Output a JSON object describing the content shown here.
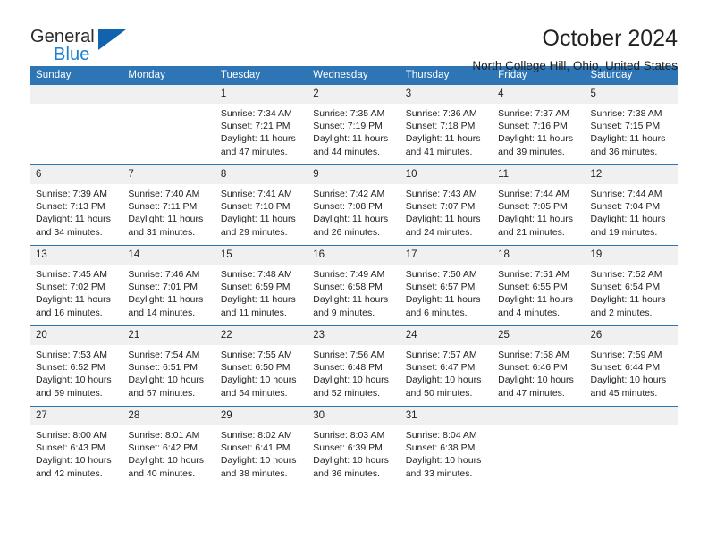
{
  "brand": {
    "name_part1": "General",
    "name_part2": "Blue",
    "flag_icon": "blue-triangle-flag",
    "accent_color": "#1263ad",
    "accent_color_light": "#1b7fd4"
  },
  "header": {
    "title": "October 2024",
    "subtitle": "North College Hill, Ohio, United States"
  },
  "theme": {
    "header_bar_color": "#2e75b6",
    "daynum_band_color": "#f0f0f0",
    "row_divider_color": "#2e75b6",
    "text_color": "#222222"
  },
  "weekdays": [
    "Sunday",
    "Monday",
    "Tuesday",
    "Wednesday",
    "Thursday",
    "Friday",
    "Saturday"
  ],
  "labels": {
    "sunrise_prefix": "Sunrise: ",
    "sunset_prefix": "Sunset: ",
    "daylight_prefix": "Daylight: "
  },
  "weeks": [
    [
      {
        "day": "",
        "empty": true
      },
      {
        "day": "",
        "empty": true
      },
      {
        "day": "1",
        "sunrise": "Sunrise: 7:34 AM",
        "sunset": "Sunset: 7:21 PM",
        "daylight_line1": "Daylight: 11 hours",
        "daylight_line2": "and 47 minutes."
      },
      {
        "day": "2",
        "sunrise": "Sunrise: 7:35 AM",
        "sunset": "Sunset: 7:19 PM",
        "daylight_line1": "Daylight: 11 hours",
        "daylight_line2": "and 44 minutes."
      },
      {
        "day": "3",
        "sunrise": "Sunrise: 7:36 AM",
        "sunset": "Sunset: 7:18 PM",
        "daylight_line1": "Daylight: 11 hours",
        "daylight_line2": "and 41 minutes."
      },
      {
        "day": "4",
        "sunrise": "Sunrise: 7:37 AM",
        "sunset": "Sunset: 7:16 PM",
        "daylight_line1": "Daylight: 11 hours",
        "daylight_line2": "and 39 minutes."
      },
      {
        "day": "5",
        "sunrise": "Sunrise: 7:38 AM",
        "sunset": "Sunset: 7:15 PM",
        "daylight_line1": "Daylight: 11 hours",
        "daylight_line2": "and 36 minutes."
      }
    ],
    [
      {
        "day": "6",
        "sunrise": "Sunrise: 7:39 AM",
        "sunset": "Sunset: 7:13 PM",
        "daylight_line1": "Daylight: 11 hours",
        "daylight_line2": "and 34 minutes."
      },
      {
        "day": "7",
        "sunrise": "Sunrise: 7:40 AM",
        "sunset": "Sunset: 7:11 PM",
        "daylight_line1": "Daylight: 11 hours",
        "daylight_line2": "and 31 minutes."
      },
      {
        "day": "8",
        "sunrise": "Sunrise: 7:41 AM",
        "sunset": "Sunset: 7:10 PM",
        "daylight_line1": "Daylight: 11 hours",
        "daylight_line2": "and 29 minutes."
      },
      {
        "day": "9",
        "sunrise": "Sunrise: 7:42 AM",
        "sunset": "Sunset: 7:08 PM",
        "daylight_line1": "Daylight: 11 hours",
        "daylight_line2": "and 26 minutes."
      },
      {
        "day": "10",
        "sunrise": "Sunrise: 7:43 AM",
        "sunset": "Sunset: 7:07 PM",
        "daylight_line1": "Daylight: 11 hours",
        "daylight_line2": "and 24 minutes."
      },
      {
        "day": "11",
        "sunrise": "Sunrise: 7:44 AM",
        "sunset": "Sunset: 7:05 PM",
        "daylight_line1": "Daylight: 11 hours",
        "daylight_line2": "and 21 minutes."
      },
      {
        "day": "12",
        "sunrise": "Sunrise: 7:44 AM",
        "sunset": "Sunset: 7:04 PM",
        "daylight_line1": "Daylight: 11 hours",
        "daylight_line2": "and 19 minutes."
      }
    ],
    [
      {
        "day": "13",
        "sunrise": "Sunrise: 7:45 AM",
        "sunset": "Sunset: 7:02 PM",
        "daylight_line1": "Daylight: 11 hours",
        "daylight_line2": "and 16 minutes."
      },
      {
        "day": "14",
        "sunrise": "Sunrise: 7:46 AM",
        "sunset": "Sunset: 7:01 PM",
        "daylight_line1": "Daylight: 11 hours",
        "daylight_line2": "and 14 minutes."
      },
      {
        "day": "15",
        "sunrise": "Sunrise: 7:48 AM",
        "sunset": "Sunset: 6:59 PM",
        "daylight_line1": "Daylight: 11 hours",
        "daylight_line2": "and 11 minutes."
      },
      {
        "day": "16",
        "sunrise": "Sunrise: 7:49 AM",
        "sunset": "Sunset: 6:58 PM",
        "daylight_line1": "Daylight: 11 hours",
        "daylight_line2": "and 9 minutes."
      },
      {
        "day": "17",
        "sunrise": "Sunrise: 7:50 AM",
        "sunset": "Sunset: 6:57 PM",
        "daylight_line1": "Daylight: 11 hours",
        "daylight_line2": "and 6 minutes."
      },
      {
        "day": "18",
        "sunrise": "Sunrise: 7:51 AM",
        "sunset": "Sunset: 6:55 PM",
        "daylight_line1": "Daylight: 11 hours",
        "daylight_line2": "and 4 minutes."
      },
      {
        "day": "19",
        "sunrise": "Sunrise: 7:52 AM",
        "sunset": "Sunset: 6:54 PM",
        "daylight_line1": "Daylight: 11 hours",
        "daylight_line2": "and 2 minutes."
      }
    ],
    [
      {
        "day": "20",
        "sunrise": "Sunrise: 7:53 AM",
        "sunset": "Sunset: 6:52 PM",
        "daylight_line1": "Daylight: 10 hours",
        "daylight_line2": "and 59 minutes."
      },
      {
        "day": "21",
        "sunrise": "Sunrise: 7:54 AM",
        "sunset": "Sunset: 6:51 PM",
        "daylight_line1": "Daylight: 10 hours",
        "daylight_line2": "and 57 minutes."
      },
      {
        "day": "22",
        "sunrise": "Sunrise: 7:55 AM",
        "sunset": "Sunset: 6:50 PM",
        "daylight_line1": "Daylight: 10 hours",
        "daylight_line2": "and 54 minutes."
      },
      {
        "day": "23",
        "sunrise": "Sunrise: 7:56 AM",
        "sunset": "Sunset: 6:48 PM",
        "daylight_line1": "Daylight: 10 hours",
        "daylight_line2": "and 52 minutes."
      },
      {
        "day": "24",
        "sunrise": "Sunrise: 7:57 AM",
        "sunset": "Sunset: 6:47 PM",
        "daylight_line1": "Daylight: 10 hours",
        "daylight_line2": "and 50 minutes."
      },
      {
        "day": "25",
        "sunrise": "Sunrise: 7:58 AM",
        "sunset": "Sunset: 6:46 PM",
        "daylight_line1": "Daylight: 10 hours",
        "daylight_line2": "and 47 minutes."
      },
      {
        "day": "26",
        "sunrise": "Sunrise: 7:59 AM",
        "sunset": "Sunset: 6:44 PM",
        "daylight_line1": "Daylight: 10 hours",
        "daylight_line2": "and 45 minutes."
      }
    ],
    [
      {
        "day": "27",
        "sunrise": "Sunrise: 8:00 AM",
        "sunset": "Sunset: 6:43 PM",
        "daylight_line1": "Daylight: 10 hours",
        "daylight_line2": "and 42 minutes."
      },
      {
        "day": "28",
        "sunrise": "Sunrise: 8:01 AM",
        "sunset": "Sunset: 6:42 PM",
        "daylight_line1": "Daylight: 10 hours",
        "daylight_line2": "and 40 minutes."
      },
      {
        "day": "29",
        "sunrise": "Sunrise: 8:02 AM",
        "sunset": "Sunset: 6:41 PM",
        "daylight_line1": "Daylight: 10 hours",
        "daylight_line2": "and 38 minutes."
      },
      {
        "day": "30",
        "sunrise": "Sunrise: 8:03 AM",
        "sunset": "Sunset: 6:39 PM",
        "daylight_line1": "Daylight: 10 hours",
        "daylight_line2": "and 36 minutes."
      },
      {
        "day": "31",
        "sunrise": "Sunrise: 8:04 AM",
        "sunset": "Sunset: 6:38 PM",
        "daylight_line1": "Daylight: 10 hours",
        "daylight_line2": "and 33 minutes."
      },
      {
        "day": "",
        "empty": true
      },
      {
        "day": "",
        "empty": true
      }
    ]
  ]
}
